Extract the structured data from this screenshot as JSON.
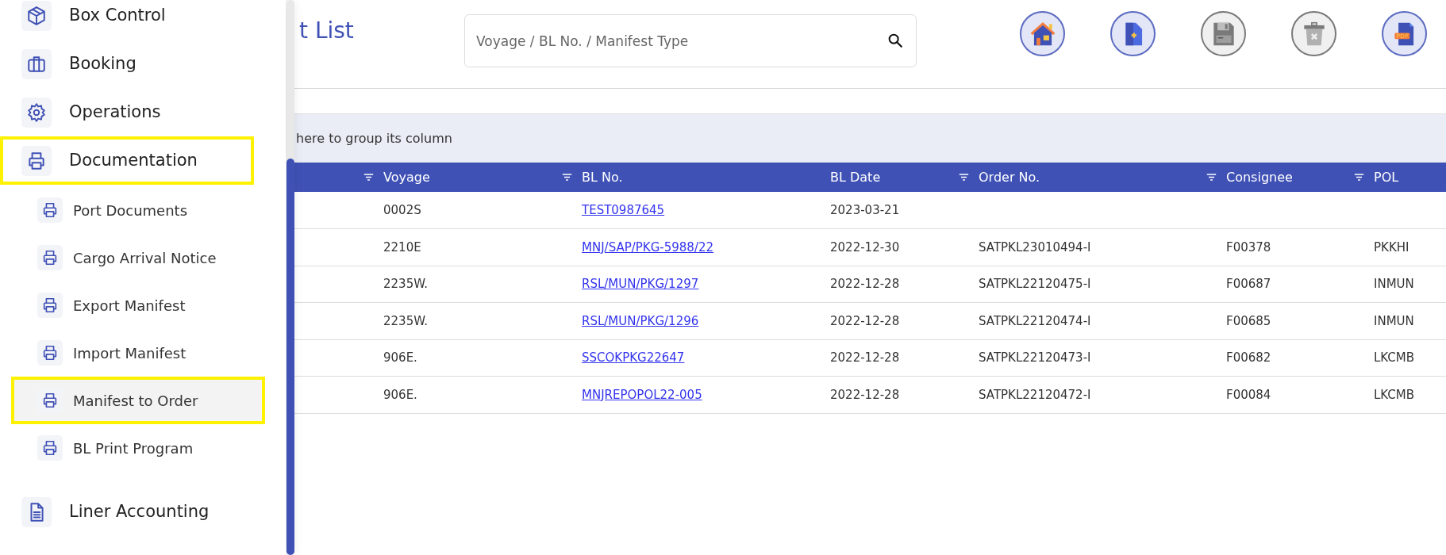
{
  "sidebar": {
    "items": [
      {
        "label": "Box Control",
        "kind": "cube",
        "selected": false,
        "highlighted": false
      },
      {
        "label": "Booking",
        "kind": "briefcase",
        "selected": false,
        "highlighted": false
      },
      {
        "label": "Operations",
        "kind": "gear",
        "selected": false,
        "highlighted": false
      },
      {
        "label": "Documentation",
        "kind": "printer",
        "selected": false,
        "highlighted": true,
        "expanded": true,
        "children": [
          {
            "label": "Port Documents",
            "selected": false,
            "highlighted": false
          },
          {
            "label": "Cargo Arrival Notice",
            "selected": false,
            "highlighted": false
          },
          {
            "label": "Export Manifest",
            "selected": false,
            "highlighted": false
          },
          {
            "label": "Import Manifest",
            "selected": false,
            "highlighted": false
          },
          {
            "label": "Manifest to Order",
            "selected": true,
            "highlighted": true
          },
          {
            "label": "BL Print Program",
            "selected": false,
            "highlighted": false
          }
        ]
      },
      {
        "label": "Liner Accounting",
        "kind": "document",
        "selected": false,
        "highlighted": false
      }
    ]
  },
  "page": {
    "title": "t List"
  },
  "search": {
    "placeholder": "Voyage / BL No. / Manifest Type"
  },
  "toolbar": [
    {
      "kind": "home",
      "disabled": false
    },
    {
      "kind": "new",
      "disabled": false
    },
    {
      "kind": "save",
      "disabled": true
    },
    {
      "kind": "delete",
      "disabled": true
    },
    {
      "kind": "pdf",
      "disabled": false
    }
  ],
  "group_panel": {
    "text": "here to group its column"
  },
  "table": {
    "columns": [
      {
        "filter": true
      },
      {
        "label": "Voyage",
        "filter": true
      },
      {
        "label": "BL No.",
        "filter": false
      },
      {
        "label": "BL Date",
        "filter": true
      },
      {
        "label": "Order No.",
        "filter": true
      },
      {
        "label": "Consignee",
        "filter": true
      },
      {
        "label": "POL",
        "filter": false
      }
    ],
    "rows": [
      {
        "cells": [
          null,
          "0002S",
          "TEST0987645",
          "2023-03-21",
          null,
          null,
          null
        ]
      },
      {
        "cells": [
          null,
          "2210E",
          "MNJ/SAP/PKG-5988/22",
          "2022-12-30",
          "SATPKL23010494-I",
          "F00378",
          "PKKHI"
        ]
      },
      {
        "cells": [
          null,
          "2235W.",
          "RSL/MUN/PKG/1297",
          "2022-12-28",
          "SATPKL22120475-I",
          "F00687",
          "INMUN"
        ]
      },
      {
        "cells": [
          null,
          "2235W.",
          "RSL/MUN/PKG/1296",
          "2022-12-28",
          "SATPKL22120474-I",
          "F00685",
          "INMUN"
        ]
      },
      {
        "cells": [
          null,
          "906E.",
          "SSCOKPKG22647",
          "2022-12-28",
          "SATPKL22120473-I",
          "F00682",
          "LKCMB"
        ]
      },
      {
        "cells": [
          null,
          "906E.",
          "MNJREPOPOL22-005",
          "2022-12-28",
          "SATPKL22120472-I",
          "F00084",
          "LKCMB"
        ]
      }
    ]
  }
}
